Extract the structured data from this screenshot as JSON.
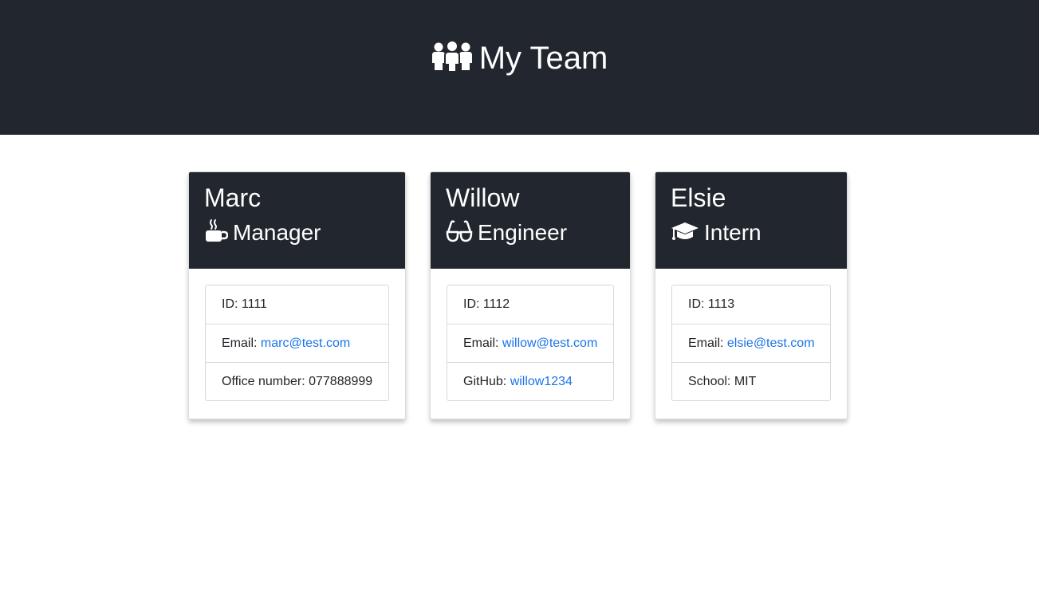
{
  "header": {
    "title": "My Team",
    "icon": "users-icon"
  },
  "colors": {
    "header_bg": "#22262e",
    "link": "#1a73e8"
  },
  "cards": [
    {
      "name": "Marc",
      "role": "Manager",
      "role_icon": "coffee-mug-icon",
      "id_label": "ID: ",
      "id": "1111",
      "email_label": "Email: ",
      "email": "marc@test.com",
      "extra_label": "Office number: ",
      "extra_value": "077888999"
    },
    {
      "name": "Willow",
      "role": "Engineer",
      "role_icon": "glasses-icon",
      "id_label": "ID: ",
      "id": "1112",
      "email_label": "Email: ",
      "email": "willow@test.com",
      "extra_label": "GitHub: ",
      "extra_value": "willow1234"
    },
    {
      "name": "Elsie",
      "role": "Intern",
      "role_icon": "graduation-cap-icon",
      "id_label": "ID: ",
      "id": "1113",
      "email_label": "Email: ",
      "email": "elsie@test.com",
      "extra_label": "School: ",
      "extra_value": "MIT"
    }
  ]
}
